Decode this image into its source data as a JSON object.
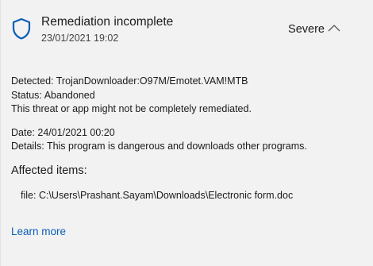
{
  "header": {
    "title": "Remediation incomplete",
    "timestamp": "23/01/2021 19:02",
    "severity": "Severe",
    "shield_icon": "shield-icon",
    "collapse_icon": "chevron-up-icon",
    "accent_color": "#0a5eb8"
  },
  "details": {
    "detected_label": "Detected:",
    "detected_value": "TrojanDownloader:O97M/Emotet.VAM!MTB",
    "status_label": "Status:",
    "status_value": "Abandoned",
    "status_note": "This threat or app might not be completely remediated.",
    "date_label": "Date:",
    "date_value": "24/01/2021 00:20",
    "details_label": "Details:",
    "details_value": "This program is dangerous and downloads other programs."
  },
  "affected": {
    "title": "Affected items:",
    "items": [
      {
        "prefix": "file:",
        "path": "C:\\Users\\Prashant.Sayam\\Downloads\\Electronic form.doc"
      }
    ]
  },
  "footer": {
    "learn_more": "Learn more"
  }
}
